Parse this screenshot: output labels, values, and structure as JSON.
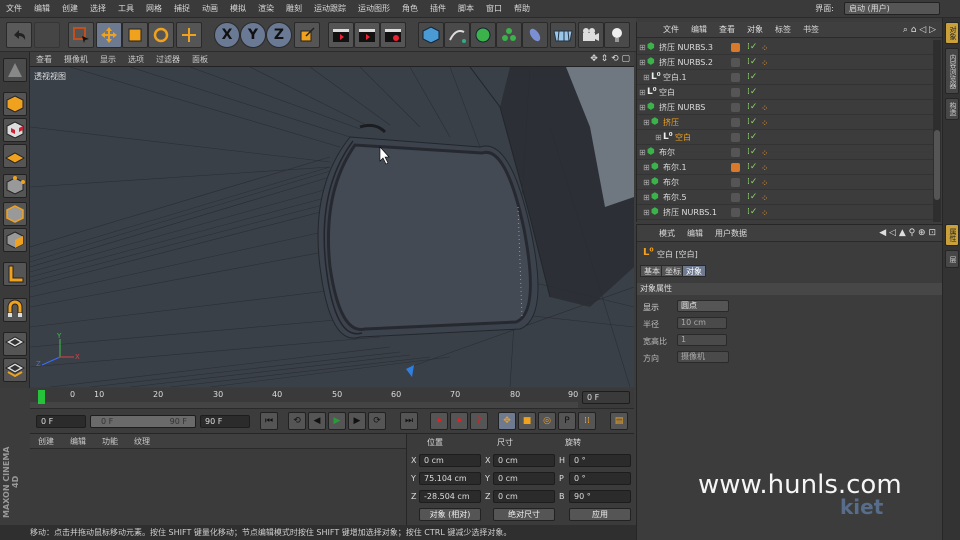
{
  "menubar": {
    "items": [
      "文件",
      "编辑",
      "创建",
      "选择",
      "工具",
      "网格",
      "捕捉",
      "动画",
      "模拟",
      "渲染",
      "雕刻",
      "运动跟踪",
      "运动图形",
      "角色",
      "插件",
      "脚本",
      "窗口",
      "帮助"
    ],
    "interface_label": "界面:",
    "interface_value": "启动 (用户)"
  },
  "viewport": {
    "menu": [
      "查看",
      "摄像机",
      "显示",
      "选项",
      "过滤器",
      "面板"
    ],
    "label": "透视视图"
  },
  "timeline": {
    "ticks": [
      "0",
      "10",
      "20",
      "30",
      "40",
      "50",
      "60",
      "70",
      "80",
      "90"
    ],
    "end_frame_field": "0 F"
  },
  "transport": {
    "current_frame": "0 F",
    "range_start": "0 F",
    "range_end": "90 F",
    "max_frame": "90 F"
  },
  "material_panel": {
    "menu": [
      "创建",
      "编辑",
      "功能",
      "纹理"
    ]
  },
  "coordinates": {
    "headers": [
      "位置",
      "尺寸",
      "旋转"
    ],
    "rows": [
      {
        "axis": "X",
        "pos": "0 cm",
        "size_axis": "X",
        "size": "0 cm",
        "rot_axis": "H",
        "rot": "0 °"
      },
      {
        "axis": "Y",
        "pos": "75.104 cm",
        "size_axis": "Y",
        "size": "0 cm",
        "rot_axis": "P",
        "rot": "0 °"
      },
      {
        "axis": "Z",
        "pos": "-28.504 cm",
        "size_axis": "Z",
        "size": "0 cm",
        "rot_axis": "B",
        "rot": "90 °"
      }
    ],
    "mode_select": "对象 (相对)",
    "size_select": "绝对尺寸",
    "apply_label": "应用"
  },
  "statusbar": {
    "text": "移动：点击并拖动鼠标移动元素。按住 SHIFT 键量化移动；节点编辑模式时按住 SHIFT 键增加选择对象；按住 CTRL 键减少选择对象。"
  },
  "brand": "MAXON CINEMA 4D",
  "object_manager": {
    "menu": [
      "文件",
      "编辑",
      "查看",
      "对象",
      "标签",
      "书签"
    ],
    "objects": [
      {
        "name": "挤压 NURBS.3",
        "color": "#d97a2a",
        "selected": false
      },
      {
        "name": "挤压 NURBS.2",
        "color": "#555555",
        "selected": false
      },
      {
        "name": "空白.1",
        "color": "#555555",
        "selected": false
      },
      {
        "name": "空白",
        "color": "#555555",
        "selected": false
      },
      {
        "name": "挤压 NURBS",
        "color": "#555555",
        "selected": false
      },
      {
        "name": "挤压",
        "color": "#555555",
        "selected": true
      },
      {
        "name": "空白",
        "color": "#555555",
        "selected": true
      },
      {
        "name": "布尔",
        "color": "#555555",
        "selected": false
      },
      {
        "name": "布尔.1",
        "color": "#d97a2a",
        "selected": false
      },
      {
        "name": "布尔",
        "color": "#555555",
        "selected": false
      },
      {
        "name": "布尔.5",
        "color": "#555555",
        "selected": false
      },
      {
        "name": "挤压 NURBS.1",
        "color": "#555555",
        "selected": false
      }
    ]
  },
  "attribute_manager": {
    "menu": [
      "模式",
      "编辑",
      "用户数据"
    ],
    "object_title": "空白 [空白]",
    "tabs": [
      "基本",
      "坐标",
      "对象"
    ],
    "section": "对象属性",
    "fields": [
      {
        "label": "显示",
        "value": "圆点"
      },
      {
        "label": "半径",
        "value": "10 cm"
      },
      {
        "label": "宽高比",
        "value": "1"
      },
      {
        "label": "方向",
        "value": "摄像机"
      }
    ]
  },
  "right_tabs": [
    "对象",
    "内容浏览器",
    "构造",
    "属性",
    "层"
  ],
  "watermark": "www.hunls.com",
  "watermark2": "kiet"
}
